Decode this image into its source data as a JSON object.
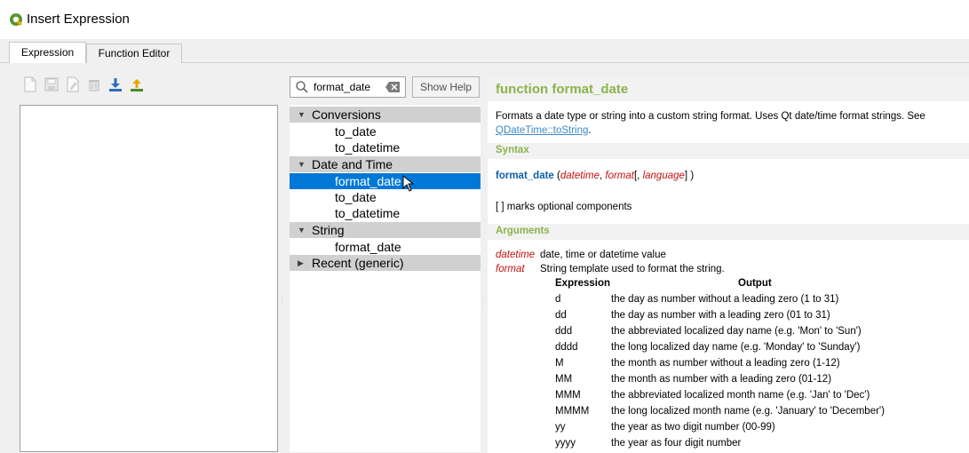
{
  "window": {
    "title": "Insert Expression",
    "icon": "qgis-logo-icon"
  },
  "tabs": [
    {
      "label": "Expression",
      "active": true
    },
    {
      "label": "Function Editor",
      "active": false
    }
  ],
  "toolbar": {
    "icons": [
      "new-file-icon",
      "save-icon",
      "edit-icon",
      "delete-icon",
      "import-icon",
      "export-icon"
    ]
  },
  "search": {
    "value": "format_date"
  },
  "show_help_label": "Show Help",
  "tree": {
    "rows": [
      {
        "label": "Conversions",
        "type": "group",
        "expanded": true
      },
      {
        "label": "to_date",
        "type": "item"
      },
      {
        "label": "to_datetime",
        "type": "item"
      },
      {
        "label": "Date and Time",
        "type": "group",
        "expanded": true
      },
      {
        "label": "format_date",
        "type": "item",
        "selected": true
      },
      {
        "label": "to_date",
        "type": "item"
      },
      {
        "label": "to_datetime",
        "type": "item"
      },
      {
        "label": "String",
        "type": "group",
        "expanded": true
      },
      {
        "label": "format_date",
        "type": "item"
      },
      {
        "label": "Recent (generic)",
        "type": "group",
        "expanded": false
      }
    ]
  },
  "help": {
    "title": "function format_date",
    "description": "Formats a date type or string into a custom string format. Uses Qt date/time format strings. See",
    "link": "QDateTime::toString",
    "link_suffix": ".",
    "syntax_label": "Syntax",
    "syntax": {
      "fn": "format_date",
      "open": "(",
      "arg1": "datetime",
      "sep1": ",",
      "arg2": "format",
      "bracket_open": "[,",
      "arg3": "language",
      "bracket_close": "]",
      "close": ")"
    },
    "optional_note": "[ ] marks optional components",
    "arguments_label": "Arguments",
    "arguments": [
      {
        "name": "datetime",
        "desc": "date, time or datetime value"
      },
      {
        "name": "format",
        "desc": "String template used to format the string."
      }
    ],
    "format_table": {
      "headers": [
        "Expression",
        "Output"
      ],
      "rows": [
        [
          "d",
          "the day as number without a leading zero (1 to 31)"
        ],
        [
          "dd",
          "the day as number with a leading zero (01 to 31)"
        ],
        [
          "ddd",
          "the abbreviated localized day name (e.g. 'Mon' to 'Sun')"
        ],
        [
          "dddd",
          "the long localized day name (e.g. 'Monday' to 'Sunday')"
        ],
        [
          "M",
          "the month as number without a leading zero (1-12)"
        ],
        [
          "MM",
          "the month as number with a leading zero (01-12)"
        ],
        [
          "MMM",
          "the abbreviated localized month name (e.g. 'Jan' to 'Dec')"
        ],
        [
          "MMMM",
          "the long localized month name (e.g. 'January' to 'December')"
        ],
        [
          "yy",
          "the year as two digit number (00-99)"
        ],
        [
          "yyyy",
          "the year as four digit number"
        ]
      ]
    }
  },
  "colors": {
    "accent_green": "#8ab44b",
    "selection_blue": "#0078d7",
    "arg_red": "#c41010",
    "fn_blue": "#0d5fa6"
  }
}
